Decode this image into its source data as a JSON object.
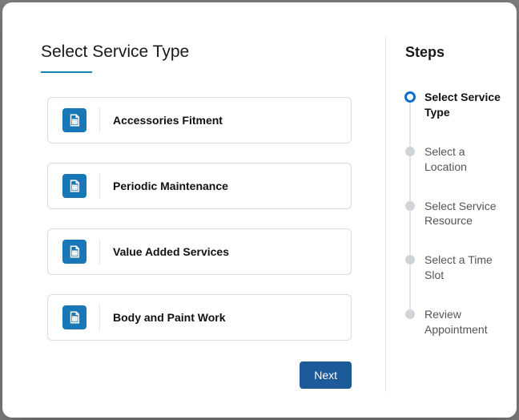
{
  "title": "Select Service Type",
  "options": [
    {
      "label": "Accessories Fitment"
    },
    {
      "label": "Periodic Maintenance"
    },
    {
      "label": "Value Added Services"
    },
    {
      "label": "Body and Paint Work"
    }
  ],
  "next_label": "Next",
  "steps_title": "Steps",
  "steps": [
    {
      "label": "Select Service Type",
      "active": true
    },
    {
      "label": "Select a Location",
      "active": false
    },
    {
      "label": "Select Service Resource",
      "active": false
    },
    {
      "label": "Select a Time Slot",
      "active": false
    },
    {
      "label": "Review Appointment",
      "active": false
    }
  ]
}
